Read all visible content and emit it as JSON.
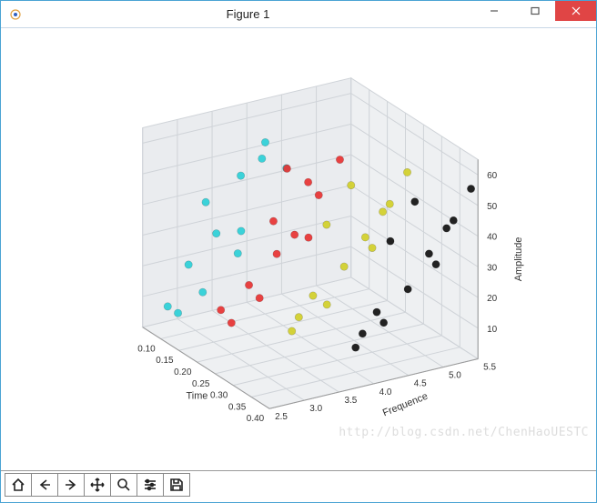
{
  "window": {
    "title": "Figure 1"
  },
  "toolbar": {
    "home": "Home",
    "back": "Back",
    "forward": "Forward",
    "pan": "Pan",
    "zoom": "Zoom",
    "subplots": "Configure subplots",
    "save": "Save"
  },
  "watermark": "http://blog.csdn.net/ChenHaoUESTC",
  "chart_data": {
    "type": "scatter",
    "xlabel": "Time",
    "ylabel": "Frequence",
    "zlabel": "Amplitude",
    "xlim": [
      0.05,
      0.4
    ],
    "ylim": [
      2.5,
      5.5
    ],
    "zlim": [
      0,
      65
    ],
    "xticks": [
      0.1,
      0.15,
      0.2,
      0.25,
      0.3,
      0.35,
      0.4
    ],
    "yticks": [
      2.5,
      3.0,
      3.5,
      4.0,
      4.5,
      5.0,
      5.5
    ],
    "zticks": [
      10,
      20,
      30,
      40,
      50,
      60
    ],
    "series": [
      {
        "name": "cyan",
        "color": "#2dd0d8",
        "points": [
          {
            "x": 0.1,
            "y": 2.6,
            "z": 10
          },
          {
            "x": 0.12,
            "y": 3.0,
            "z": 14
          },
          {
            "x": 0.1,
            "y": 3.3,
            "z": 30
          },
          {
            "x": 0.13,
            "y": 3.5,
            "z": 32
          },
          {
            "x": 0.09,
            "y": 3.2,
            "z": 40
          },
          {
            "x": 0.11,
            "y": 3.6,
            "z": 48
          },
          {
            "x": 0.12,
            "y": 3.9,
            "z": 58
          },
          {
            "x": 0.14,
            "y": 4.1,
            "z": 50
          },
          {
            "x": 0.1,
            "y": 2.9,
            "z": 22
          },
          {
            "x": 0.13,
            "y": 3.8,
            "z": 54
          },
          {
            "x": 0.09,
            "y": 2.8,
            "z": 6
          },
          {
            "x": 0.14,
            "y": 3.4,
            "z": 26
          }
        ]
      },
      {
        "name": "red",
        "color": "#e83333",
        "points": [
          {
            "x": 0.18,
            "y": 3.1,
            "z": 8
          },
          {
            "x": 0.2,
            "y": 3.4,
            "z": 16
          },
          {
            "x": 0.19,
            "y": 3.7,
            "z": 28
          },
          {
            "x": 0.22,
            "y": 4.0,
            "z": 34
          },
          {
            "x": 0.2,
            "y": 3.6,
            "z": 40
          },
          {
            "x": 0.21,
            "y": 4.2,
            "z": 46
          },
          {
            "x": 0.18,
            "y": 3.9,
            "z": 54
          },
          {
            "x": 0.23,
            "y": 4.4,
            "z": 58
          },
          {
            "x": 0.19,
            "y": 3.3,
            "z": 20
          },
          {
            "x": 0.22,
            "y": 3.8,
            "z": 36
          },
          {
            "x": 0.2,
            "y": 4.1,
            "z": 50
          },
          {
            "x": 0.17,
            "y": 3.0,
            "z": 12
          }
        ]
      },
      {
        "name": "yellow",
        "color": "#d2d02a",
        "points": [
          {
            "x": 0.27,
            "y": 3.5,
            "z": 10
          },
          {
            "x": 0.29,
            "y": 3.9,
            "z": 18
          },
          {
            "x": 0.28,
            "y": 4.2,
            "z": 28
          },
          {
            "x": 0.3,
            "y": 4.5,
            "z": 34
          },
          {
            "x": 0.27,
            "y": 4.0,
            "z": 42
          },
          {
            "x": 0.31,
            "y": 4.7,
            "z": 48
          },
          {
            "x": 0.28,
            "y": 4.3,
            "z": 54
          },
          {
            "x": 0.32,
            "y": 4.9,
            "z": 58
          },
          {
            "x": 0.29,
            "y": 3.7,
            "z": 22
          },
          {
            "x": 0.3,
            "y": 4.4,
            "z": 38
          },
          {
            "x": 0.27,
            "y": 3.6,
            "z": 14
          },
          {
            "x": 0.31,
            "y": 4.6,
            "z": 46
          }
        ]
      },
      {
        "name": "black",
        "color": "#111111",
        "points": [
          {
            "x": 0.35,
            "y": 4.0,
            "z": 8
          },
          {
            "x": 0.37,
            "y": 4.3,
            "z": 16
          },
          {
            "x": 0.36,
            "y": 4.7,
            "z": 24
          },
          {
            "x": 0.38,
            "y": 5.0,
            "z": 32
          },
          {
            "x": 0.35,
            "y": 4.5,
            "z": 40
          },
          {
            "x": 0.39,
            "y": 5.2,
            "z": 46
          },
          {
            "x": 0.36,
            "y": 4.8,
            "z": 52
          },
          {
            "x": 0.4,
            "y": 5.4,
            "z": 56
          },
          {
            "x": 0.37,
            "y": 4.2,
            "z": 20
          },
          {
            "x": 0.38,
            "y": 4.9,
            "z": 36
          },
          {
            "x": 0.35,
            "y": 4.1,
            "z": 12
          },
          {
            "x": 0.39,
            "y": 5.1,
            "z": 44
          }
        ]
      }
    ]
  }
}
